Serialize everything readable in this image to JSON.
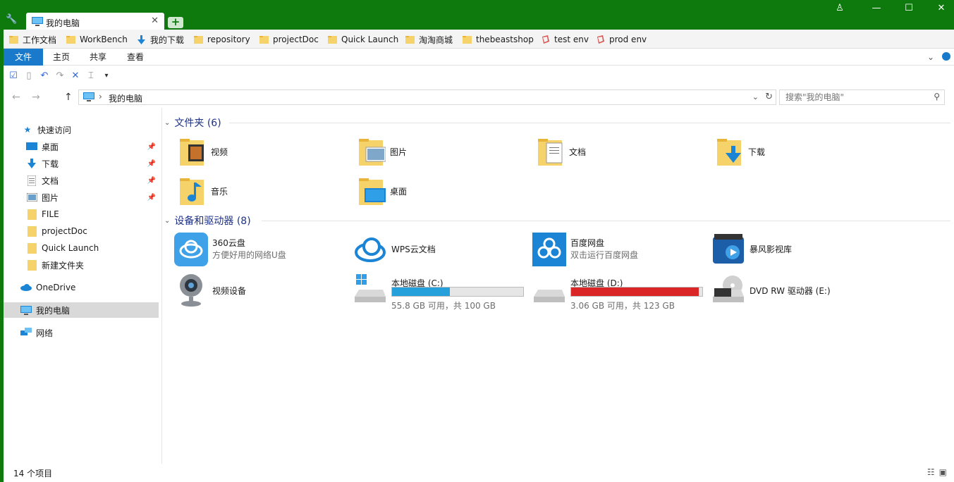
{
  "window": {
    "tab_title": "我的电脑",
    "tab_close": "✕",
    "new_tab": "+",
    "controls": [
      "♙",
      "—",
      "☐",
      "✕"
    ]
  },
  "bookmarks": [
    {
      "label": "工作文档",
      "icon": "folder-icon"
    },
    {
      "label": "WorkBench",
      "icon": "folder-icon"
    },
    {
      "label": "我的下载",
      "icon": "download-arrow-icon"
    },
    {
      "label": "repository",
      "icon": "folder-icon"
    },
    {
      "label": "projectDoc",
      "icon": "folder-icon"
    },
    {
      "label": "Quick Launch",
      "icon": "folder-icon"
    },
    {
      "label": "淘淘商城",
      "icon": "folder-icon"
    },
    {
      "label": "thebeastshop",
      "icon": "folder-icon"
    },
    {
      "label": "test env",
      "icon": "bookmark-page-icon"
    },
    {
      "label": "prod env",
      "icon": "bookmark-page-icon"
    }
  ],
  "ribbon": {
    "tabs": [
      "文件",
      "主页",
      "共享",
      "查看"
    ],
    "active": "文件",
    "expand": "⌄"
  },
  "nav": {
    "back": "←",
    "forward": "→",
    "up": "↑",
    "breadcrumb": "我的电脑",
    "search_placeholder": "搜索\"我的电脑\""
  },
  "sidebar": {
    "quick_access": "快速访问",
    "items": [
      {
        "label": "桌面",
        "pinned": true,
        "icon": "desktop-icon"
      },
      {
        "label": "下载",
        "pinned": true,
        "icon": "download-icon"
      },
      {
        "label": "文档",
        "pinned": true,
        "icon": "document-icon"
      },
      {
        "label": "图片",
        "pinned": true,
        "icon": "picture-icon"
      },
      {
        "label": "FILE",
        "pinned": false,
        "icon": "folder-icon"
      },
      {
        "label": "projectDoc",
        "pinned": false,
        "icon": "folder-icon"
      },
      {
        "label": "Quick Launch",
        "pinned": false,
        "icon": "folder-icon"
      },
      {
        "label": "新建文件夹",
        "pinned": false,
        "icon": "folder-icon"
      }
    ],
    "onedrive": "OneDrive",
    "this_pc": "我的电脑",
    "network": "网络"
  },
  "folders_group": {
    "title": "文件夹 (6)",
    "items": [
      {
        "label": "视频",
        "icon": "video-folder-icon"
      },
      {
        "label": "图片",
        "icon": "pictures-folder-icon"
      },
      {
        "label": "文档",
        "icon": "documents-folder-icon"
      },
      {
        "label": "下载",
        "icon": "downloads-folder-icon"
      },
      {
        "label": "音乐",
        "icon": "music-folder-icon"
      },
      {
        "label": "桌面",
        "icon": "desktop-folder-icon"
      }
    ]
  },
  "devices_group": {
    "title": "设备和驱动器 (8)",
    "items": [
      {
        "label": "360云盘",
        "sub": "方便好用的网络U盘",
        "icon": "cloud-360-icon"
      },
      {
        "label": "WPS云文档",
        "sub": "",
        "icon": "wps-cloud-icon"
      },
      {
        "label": "百度网盘",
        "sub": "双击运行百度网盘",
        "icon": "baidu-netdisk-icon"
      },
      {
        "label": "暴风影视库",
        "sub": "",
        "icon": "baofeng-video-icon"
      },
      {
        "label": "视频设备",
        "sub": "",
        "icon": "webcam-icon"
      },
      {
        "label": "本地磁盘 (C:)",
        "free": "55.8 GB 可用，共 100 GB",
        "used_fraction": 0.442,
        "bar_color": "#26a0da",
        "icon": "system-drive-icon"
      },
      {
        "label": "本地磁盘 (D:)",
        "free": "3.06 GB 可用，共 123 GB",
        "used_fraction": 0.975,
        "bar_color": "#da2626",
        "icon": "hard-drive-icon"
      },
      {
        "label": "DVD RW 驱动器 (E:)",
        "sub": "",
        "icon": "dvd-drive-icon"
      }
    ]
  },
  "status": {
    "count": "14 个项目"
  },
  "colors": {
    "title_bar": "#0e7a0d",
    "ribbon_active": "#1979ca",
    "group_heading": "#1e3287"
  }
}
